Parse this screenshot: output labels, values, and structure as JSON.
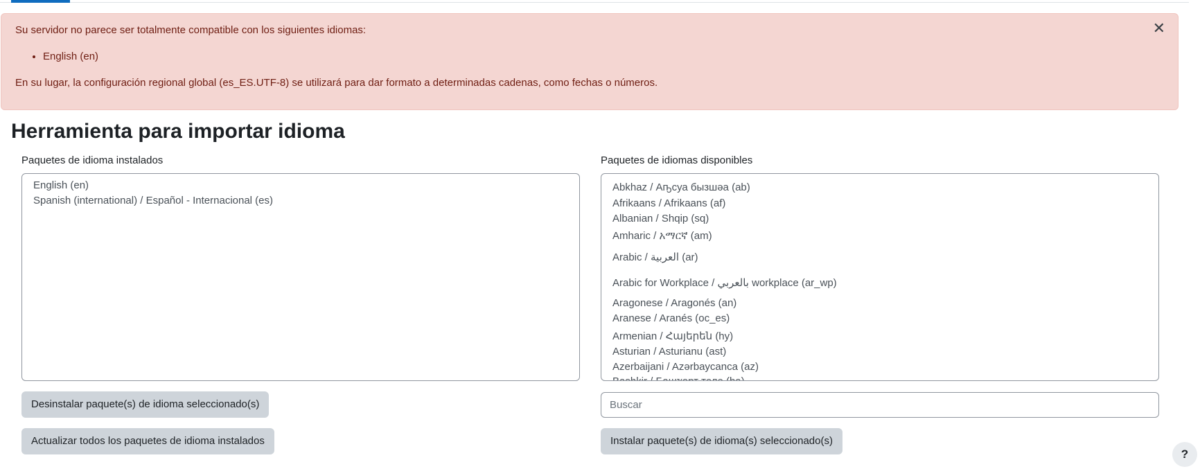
{
  "alert": {
    "message": "Su servidor no parece ser totalmente compatible con los siguientes idiomas:",
    "languages": [
      "English (en)"
    ],
    "note": "En su lugar, la configuración regional global (es_ES.UTF-8) se utilizará para dar formato a determinadas cadenas, como fechas o números.",
    "close_symbol": "✕"
  },
  "page": {
    "title": "Herramienta para importar idioma"
  },
  "installed": {
    "label": "Paquetes de idioma instalados",
    "items": [
      "English (en)",
      "Spanish (international) / Español - Internacional (es)"
    ]
  },
  "available": {
    "label": "Paquetes de idiomas disponibles",
    "items": [
      "Abkhaz / Аҧсуа бызшәа (ab)",
      "Afrikaans / Afrikaans (af)",
      "Albanian / Shqip (sq)",
      "Amharic / አማርኛ (am)",
      "Arabic / العربية (ar)",
      "Arabic for Workplace / بالعربي workplace (ar_wp)",
      "Aragonese / Aragonés (an)",
      "Aranese / Aranés (oc_es)",
      "Armenian / Հայերեն (hy)",
      "Asturian / Asturianu (ast)",
      "Azerbaijani / Azərbaycanca (az)",
      "Bashkir / Башҡорт теле (ba)"
    ]
  },
  "buttons": {
    "uninstall": "Desinstalar paquete(s) de idioma seleccionado(s)",
    "update_all": "Actualizar todos los paquetes de idioma instalados",
    "install": "Instalar paquete(s) de idioma(s) seleccionado(s)"
  },
  "search": {
    "placeholder": "Buscar",
    "value": ""
  },
  "help": {
    "symbol": "?"
  }
}
